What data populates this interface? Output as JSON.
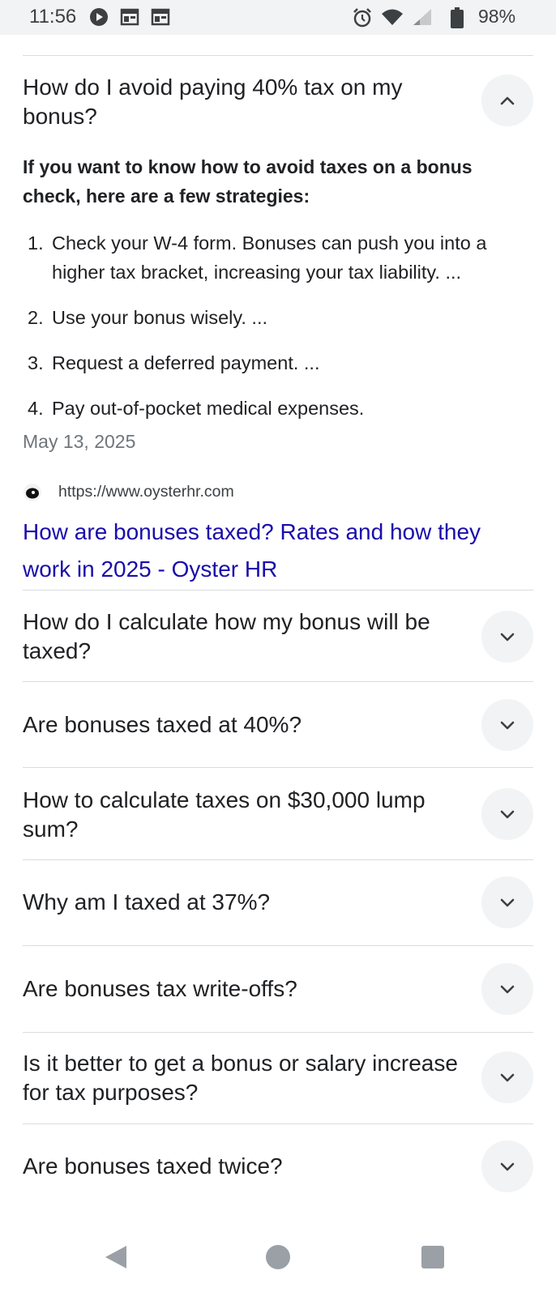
{
  "status_bar": {
    "time": "11:56",
    "battery_percent": "98%",
    "icons": [
      "play-circle-icon",
      "calendar-icon",
      "calendar-icon",
      "alarm-icon",
      "wifi-icon",
      "signal-icon",
      "battery-icon"
    ]
  },
  "expanded_question": {
    "question": "How do I avoid paying 40% tax on my bonus?",
    "answer_heading": "If you want to know how to avoid taxes on a bonus check, here are a few strategies:",
    "steps": [
      {
        "num": "1.",
        "text": "Check your W-4 form. Bonuses can push you into a higher tax bracket, increasing your tax liability. ..."
      },
      {
        "num": "2.",
        "text": "Use your bonus wisely. ..."
      },
      {
        "num": "3.",
        "text": "Request a deferred payment. ..."
      },
      {
        "num": "4.",
        "text": "Pay out-of-pocket medical expenses."
      }
    ],
    "date": "May 13, 2025",
    "source_url": "https://www.oysterhr.com",
    "source_title": "How are bonuses taxed? Rates and how they work in 2025 - Oyster HR"
  },
  "questions": [
    {
      "text": "How do I calculate how my bonus will be taxed?"
    },
    {
      "text": "Are bonuses taxed at 40%?"
    },
    {
      "text": "How to calculate taxes on $30,000 lump sum?"
    },
    {
      "text": "Why am I taxed at 37%?"
    },
    {
      "text": "Are bonuses tax write-offs?"
    },
    {
      "text": "Is it better to get a bonus or salary increase for tax purposes?"
    },
    {
      "text": "Are bonuses taxed twice?"
    }
  ],
  "nav_bar": {
    "buttons": [
      "back-icon",
      "home-icon",
      "recents-icon"
    ]
  },
  "colors": {
    "link": "#1a0dab",
    "divider": "#dadce0",
    "button_bg": "#f1f3f4",
    "text": "#202124",
    "muted": "#70757a"
  }
}
